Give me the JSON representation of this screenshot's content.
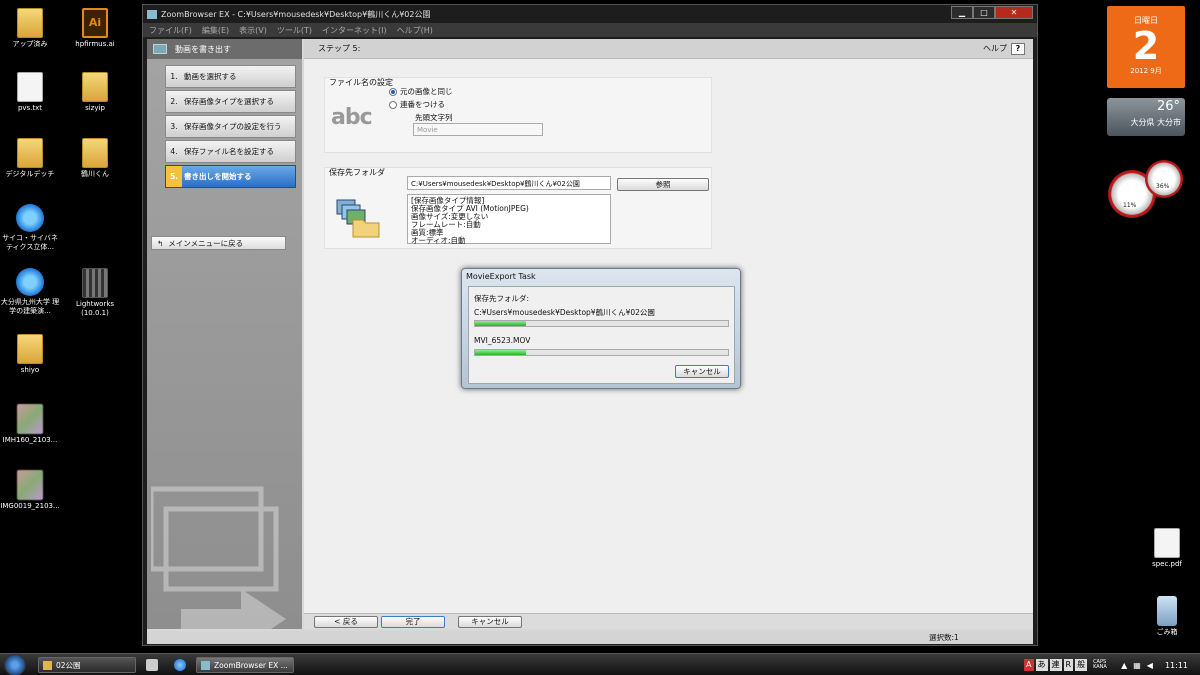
{
  "desktop": {
    "icons": [
      {
        "label": "アップ済み",
        "kind": "folder"
      },
      {
        "label": "hpfirmus.ai",
        "kind": "ai"
      },
      {
        "label": "pvs.txt",
        "kind": "file"
      },
      {
        "label": "sizyip",
        "kind": "folder"
      },
      {
        "label": "デジタルデッチ",
        "kind": "folder"
      },
      {
        "label": "鶴川くん",
        "kind": "folder"
      },
      {
        "label": "サイコ・サイバネ ティクス立体...",
        "kind": "ie"
      },
      {
        "label": "大分県九州大学 理学の建築演...",
        "kind": "ie"
      },
      {
        "label": "Lightworks (10.0.1)",
        "kind": "film"
      },
      {
        "label": "shiyo",
        "kind": "folder"
      },
      {
        "label": "IMH160_2103...",
        "kind": "thumb"
      },
      {
        "label": "IMG0019_2103...",
        "kind": "thumb"
      },
      {
        "label": "spec.pdf",
        "kind": "file"
      },
      {
        "label": "ごみ箱",
        "kind": "bin"
      }
    ],
    "calendar": {
      "dow": "日曜日",
      "day": "2",
      "ym": "2012 9月"
    },
    "weather": {
      "temp": "26°",
      "location": "大分県 大分市"
    },
    "meters": {
      "cpu": "11%",
      "mem": "36%"
    }
  },
  "window": {
    "title": "ZoomBrowser EX  -  C:¥Users¥mousedesk¥Desktop¥鶴川くん¥02公園",
    "controls": {
      "minimize": "▁",
      "maximize": "□",
      "close": "✕"
    },
    "menu": [
      "ファイル(F)",
      "編集(E)",
      "表示(V)",
      "ツール(T)",
      "インターネット(I)",
      "ヘルプ(H)"
    ],
    "left_header": "動画を書き出す",
    "steps": [
      {
        "num": "1.",
        "label": "動画を選択する"
      },
      {
        "num": "2.",
        "label": "保存画像タイプを選択する"
      },
      {
        "num": "3.",
        "label": "保存画像タイプの設定を行う"
      },
      {
        "num": "4.",
        "label": "保存ファイル名を設定する"
      },
      {
        "num": "5.",
        "label": "書き出しを開始する"
      }
    ],
    "main_menu_button": "メインメニューに戻る",
    "step_title": "ステップ 5:",
    "help_label": "ヘルプ",
    "help_icon": "?",
    "filename_group": {
      "title": "ファイル名の設定",
      "sample": "abc",
      "option_original": "元の画像と同じ",
      "option_sequence": "連番をつける",
      "prefix_label": "先頭文字列",
      "prefix_placeholder": "Movie"
    },
    "folder_group": {
      "title": "保存先フォルダ",
      "path": "C:¥Users¥mousedesk¥Desktop¥鶴川くん¥02公園",
      "browse": "参照",
      "info": [
        "[保存画像タイプ情報]",
        "保存画像タイプ AVI (MotionJPEG)",
        "画像サイズ:変更しない",
        "フレームレート:自動",
        "画質:標準",
        "オーディオ:自動"
      ]
    },
    "footer": {
      "back": "< 戻る",
      "finish": "完了",
      "cancel": "キャンセル"
    },
    "status": "選択数:1"
  },
  "dialog": {
    "title": "MovieExport Task",
    "folder_label": "保存先フォルダ:",
    "folder_path": "C:¥Users¥mousedesk¥Desktop¥鶴川くん¥02公園",
    "folder_progress": 0.2,
    "file_name": "MVI_6523.MOV",
    "file_progress": 0.2,
    "cancel": "キャンセル"
  },
  "taskbar": {
    "items": [
      "02公園",
      "ZoomBrowser EX ..."
    ],
    "ime": [
      "A",
      "あ",
      "連",
      "R",
      "般"
    ],
    "caps": "CAPS KANA",
    "clock": "11:11"
  }
}
